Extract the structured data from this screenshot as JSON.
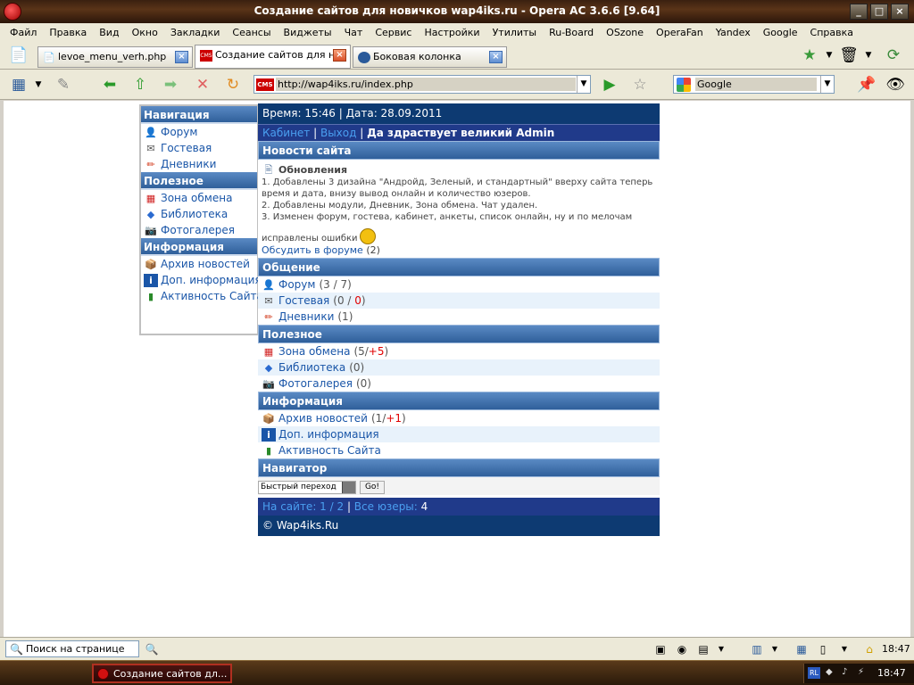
{
  "window": {
    "title": "Создание сайтов для новичков wap4iks.ru - Opera AC 3.6.6 [9.64]"
  },
  "menu": [
    "Файл",
    "Правка",
    "Вид",
    "Окно",
    "Закладки",
    "Сеансы",
    "Виджеты",
    "Чат",
    "Сервис",
    "Настройки",
    "Утилиты",
    "Ru-Board",
    "OSzone",
    "OperaFan",
    "Yandex",
    "Google",
    "Справка"
  ],
  "tabs": [
    {
      "label": "levoe_menu_verh.php",
      "active": false
    },
    {
      "label": "Создание сайтов для н...",
      "active": true
    },
    {
      "label": "Боковая колонка",
      "active": false
    }
  ],
  "address": {
    "badge": "CMS",
    "url": "http://wap4iks.ru/index.php"
  },
  "search": {
    "engine": "Google"
  },
  "sidebar": {
    "sections": [
      {
        "title": "Навигация",
        "items": [
          {
            "label": "Форум",
            "icon": "forum-icon"
          },
          {
            "label": "Гостевая",
            "icon": "guestbook-icon"
          },
          {
            "label": "Дневники",
            "icon": "pencil-icon"
          }
        ]
      },
      {
        "title": "Полезное",
        "items": [
          {
            "label": "Зона обмена",
            "icon": "exchange-icon"
          },
          {
            "label": "Библиотека",
            "icon": "book-icon"
          },
          {
            "label": "Фотогалерея",
            "icon": "camera-icon"
          }
        ]
      },
      {
        "title": "Информация",
        "items": [
          {
            "label": "Архив новостей",
            "icon": "archive-icon"
          },
          {
            "label": "Доп. информация",
            "icon": "info-icon"
          },
          {
            "label": "Активность Сайта",
            "icon": "chart-icon"
          }
        ]
      }
    ]
  },
  "main": {
    "time_label": "Время: 15:46 | Дата: 28.09.2011",
    "user": {
      "cabinet": "Кабинет",
      "sep1": " | ",
      "logout": "Выход",
      "sep2": " | ",
      "welcome": "Да здраствует великий Admin"
    },
    "news": {
      "header": "Новости сайта",
      "title": "Обновления",
      "lines": [
        "1. Добавлены 3 дизайна \"Андройд, Зеленый, и стандартный\" вверху сайта теперь время и дата, внизу вывод онлайн и количество юзеров.",
        "2. Добавлены модули, Дневник, Зона обмена. Чат удален.",
        "3. Изменен форум, гостева, кабинет, анкеты, список онлайн, ну и по мелочам"
      ],
      "fixed": "исправлены ошибки",
      "discuss": "Обсудить в форуме",
      "discuss_count": "(2)"
    },
    "sections": [
      {
        "title": "Общение",
        "rows": [
          {
            "label": "Форум",
            "icon": "forum-icon",
            "count": "(3 / 7)",
            "red": ""
          },
          {
            "label": "Гостевая",
            "icon": "guestbook-icon",
            "count": "(0 / ",
            "red": "0",
            "tail": ")"
          },
          {
            "label": "Дневники",
            "icon": "pencil-icon",
            "count": "(1)",
            "red": ""
          }
        ]
      },
      {
        "title": "Полезное",
        "rows": [
          {
            "label": "Зона обмена",
            "icon": "exchange-icon",
            "count": "(5/",
            "red": "+5",
            "tail": ")"
          },
          {
            "label": "Библиотека",
            "icon": "book-icon",
            "count": "(0)",
            "red": ""
          },
          {
            "label": "Фотогалерея",
            "icon": "camera-icon",
            "count": "(0)",
            "red": ""
          }
        ]
      },
      {
        "title": "Информация",
        "rows": [
          {
            "label": "Архив новостей",
            "icon": "archive-icon",
            "count": "(1/",
            "red": "+1",
            "tail": ")"
          },
          {
            "label": "Доп. информация",
            "icon": "info-icon",
            "count": "",
            "red": ""
          },
          {
            "label": "Активность Сайта",
            "icon": "chart-icon",
            "count": "",
            "red": ""
          }
        ]
      }
    ],
    "navigator": {
      "title": "Навигатор",
      "select": "Быстрый переход",
      "go": "Go!"
    },
    "online": {
      "label": "На сайте: 1 / 2",
      "sep": " | ",
      "users_label": "Все юзеры:",
      "users_count": "4"
    },
    "copyright": "© Wap4iks.Ru"
  },
  "statusbar": {
    "find_placeholder": "Поиск на странице",
    "time": "18:47"
  },
  "taskbar": {
    "task": "Создание сайтов дл...",
    "lang": "RL",
    "time": "18:47"
  },
  "colors": {
    "header_blue": "#2f5f9a",
    "dark_navy": "#0d3a72",
    "link_blue": "#1a56a8",
    "accent_red": "#e00000"
  }
}
